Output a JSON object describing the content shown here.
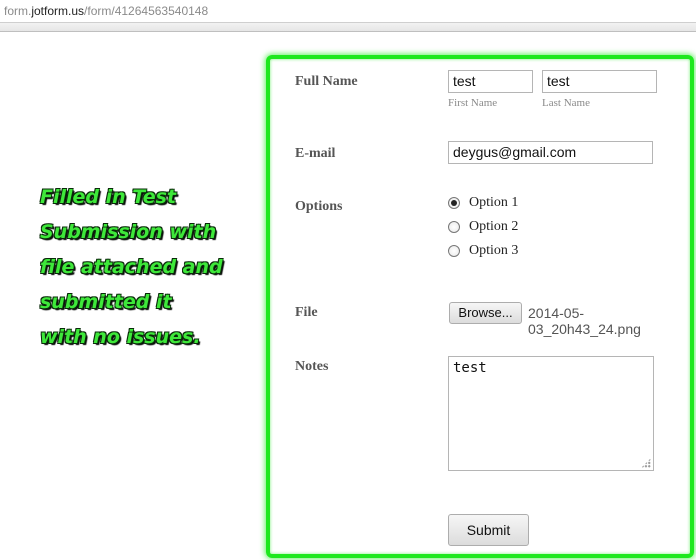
{
  "browser": {
    "url_prefix": "form.",
    "url_host": "jotform.us",
    "url_path": "/form/41264563540148"
  },
  "annotation": {
    "lines": [
      "Filled in Test",
      "Submission with",
      "file attached and",
      "submitted it",
      "with no issues."
    ],
    "color": "#3ee83a"
  },
  "highlight_color": "#1ee81e",
  "form": {
    "full_name": {
      "label": "Full Name",
      "first_value": "test",
      "first_sublabel": "First Name",
      "last_value": "test",
      "last_sublabel": "Last Name"
    },
    "email": {
      "label": "E-mail",
      "value": "deygus@gmail.com"
    },
    "options": {
      "label": "Options",
      "items": [
        {
          "label": "Option 1",
          "checked": true
        },
        {
          "label": "Option 2",
          "checked": false
        },
        {
          "label": "Option 3",
          "checked": false
        }
      ]
    },
    "file": {
      "label": "File",
      "browse_label": "Browse...",
      "filename": "2014-05-03_20h43_24.png"
    },
    "notes": {
      "label": "Notes",
      "value": "test"
    },
    "submit_label": "Submit"
  }
}
